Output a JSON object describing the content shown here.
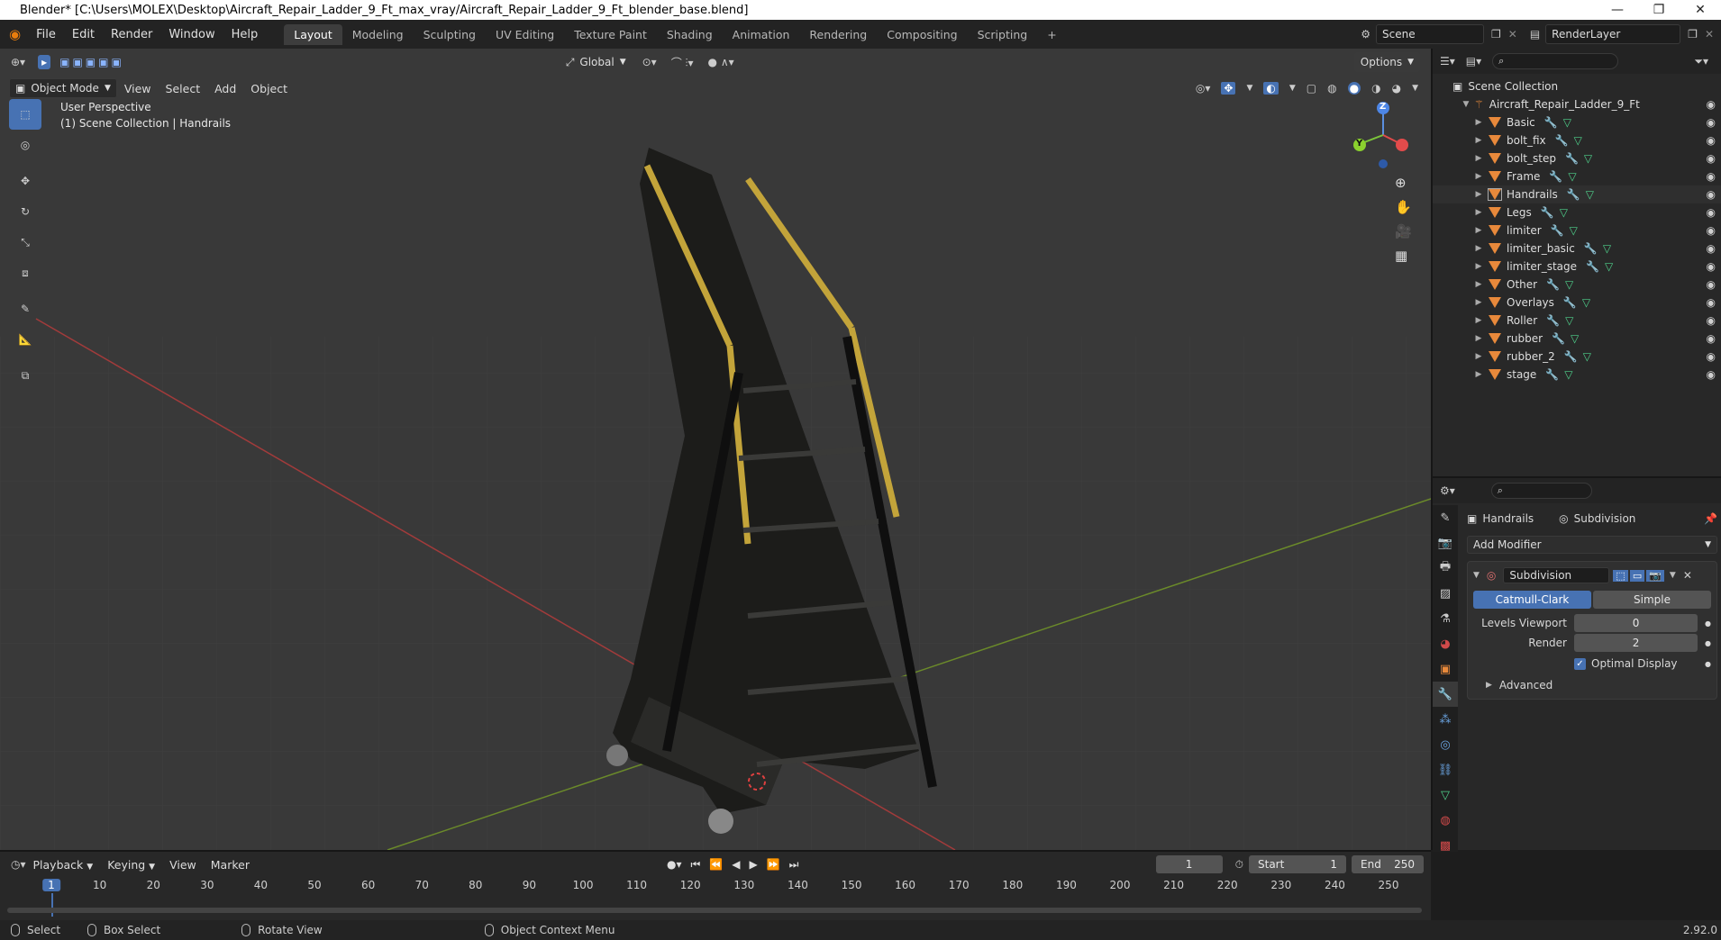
{
  "window": {
    "title": "Blender* [C:\\Users\\MOLEX\\Desktop\\Aircraft_Repair_Ladder_9_Ft_max_vray/Aircraft_Repair_Ladder_9_Ft_blender_base.blend]",
    "minimize": "—",
    "maximize": "❐",
    "close": "✕"
  },
  "menu": [
    "File",
    "Edit",
    "Render",
    "Window",
    "Help"
  ],
  "workspaces": [
    "Layout",
    "Modeling",
    "Sculpting",
    "UV Editing",
    "Texture Paint",
    "Shading",
    "Animation",
    "Rendering",
    "Compositing",
    "Scripting"
  ],
  "active_workspace": "Layout",
  "scene_name": "Scene",
  "render_layer": "RenderLayer",
  "viewport": {
    "mode": "Object Mode",
    "menus": [
      "View",
      "Select",
      "Add",
      "Object"
    ],
    "orientation": "Global",
    "options_label": "Options",
    "overlay_line1": "User Perspective",
    "overlay_line2": "(1) Scene Collection | Handrails",
    "gizmo_z": "Z",
    "gizmo_y": "Y"
  },
  "outliner": {
    "root": "Scene Collection",
    "collection": "Aircraft_Repair_Ladder_9_Ft",
    "objects": [
      "Basic",
      "bolt_fix",
      "bolt_step",
      "Frame",
      "Handrails",
      "Legs",
      "limiter",
      "limiter_basic",
      "limiter_stage",
      "Other",
      "Overlays",
      "Roller",
      "rubber",
      "rubber_2",
      "stage"
    ],
    "selected": "Handrails"
  },
  "properties": {
    "object_name": "Handrails",
    "modifier_breadcrumb": "Subdivision",
    "add_modifier": "Add Modifier",
    "modifier_name": "Subdivision",
    "method_a": "Catmull-Clark",
    "method_b": "Simple",
    "levels_viewport_label": "Levels Viewport",
    "levels_viewport_value": "0",
    "render_label": "Render",
    "render_value": "2",
    "optimal_display": "Optimal Display",
    "advanced": "Advanced"
  },
  "timeline": {
    "menus": [
      "Playback",
      "Keying",
      "View",
      "Marker"
    ],
    "current_frame": "1",
    "start_label": "Start",
    "start_value": "1",
    "end_label": "End",
    "end_value": "250",
    "ticks": [
      "1",
      "10",
      "20",
      "30",
      "40",
      "50",
      "60",
      "70",
      "80",
      "90",
      "100",
      "110",
      "120",
      "130",
      "140",
      "150",
      "160",
      "170",
      "180",
      "190",
      "200",
      "210",
      "220",
      "230",
      "240",
      "250"
    ]
  },
  "statusbar": {
    "select": "Select",
    "box_select": "Box Select",
    "rotate_view": "Rotate View",
    "context_menu": "Object Context Menu",
    "version": "2.92.0"
  }
}
